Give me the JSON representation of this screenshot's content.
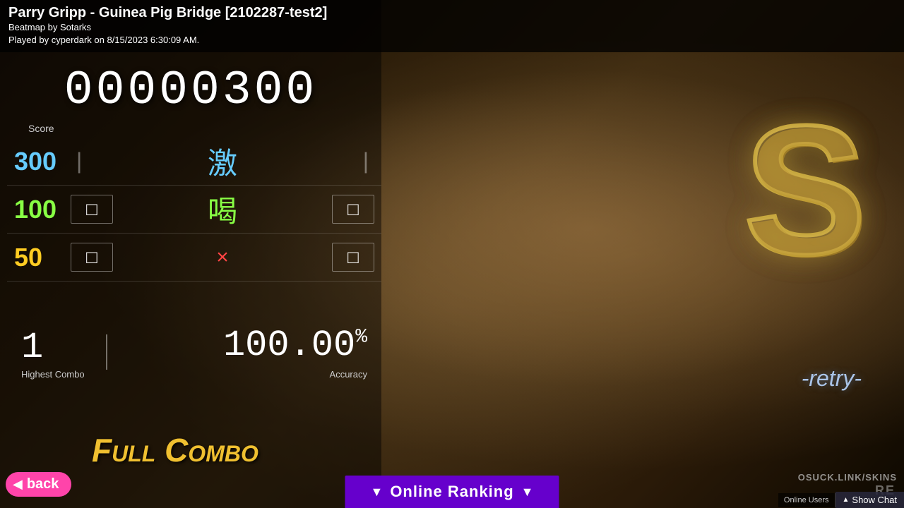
{
  "top": {
    "title": "Parry Gripp - Guinea Pig Bridge [2102287-test2]",
    "beatmap": "Beatmap by Sotarks",
    "played": "Played by cyperdark on 8/15/2023 6:30:09 AM."
  },
  "score": {
    "number": "00000300",
    "label": "Score"
  },
  "hits": {
    "row300": {
      "value": "300",
      "kanji": "激",
      "count_left": "",
      "count_right": ""
    },
    "row100": {
      "value": "100",
      "kanji": "喝",
      "count": "0"
    },
    "row50": {
      "value": "50",
      "kanji": "×",
      "count": "0"
    }
  },
  "stats": {
    "combo_value": "1",
    "combo_label": "Highest Combo",
    "accuracy_value": "100.00",
    "accuracy_symbol": "%",
    "accuracy_label": "Accuracy"
  },
  "grade": "S",
  "retry_label": "-retry-",
  "full_combo_label": "Full Combo",
  "back_label": "back",
  "online_ranking": {
    "left_arrow": "▼",
    "label": "Online Ranking",
    "right_arrow": "▼"
  },
  "skin_link": "OSUCK.LINK/SKINS",
  "re_text": "RE",
  "bottom_right": {
    "online_users": "Online Users",
    "show_chat": "Show Chat",
    "chevron": "▲"
  }
}
